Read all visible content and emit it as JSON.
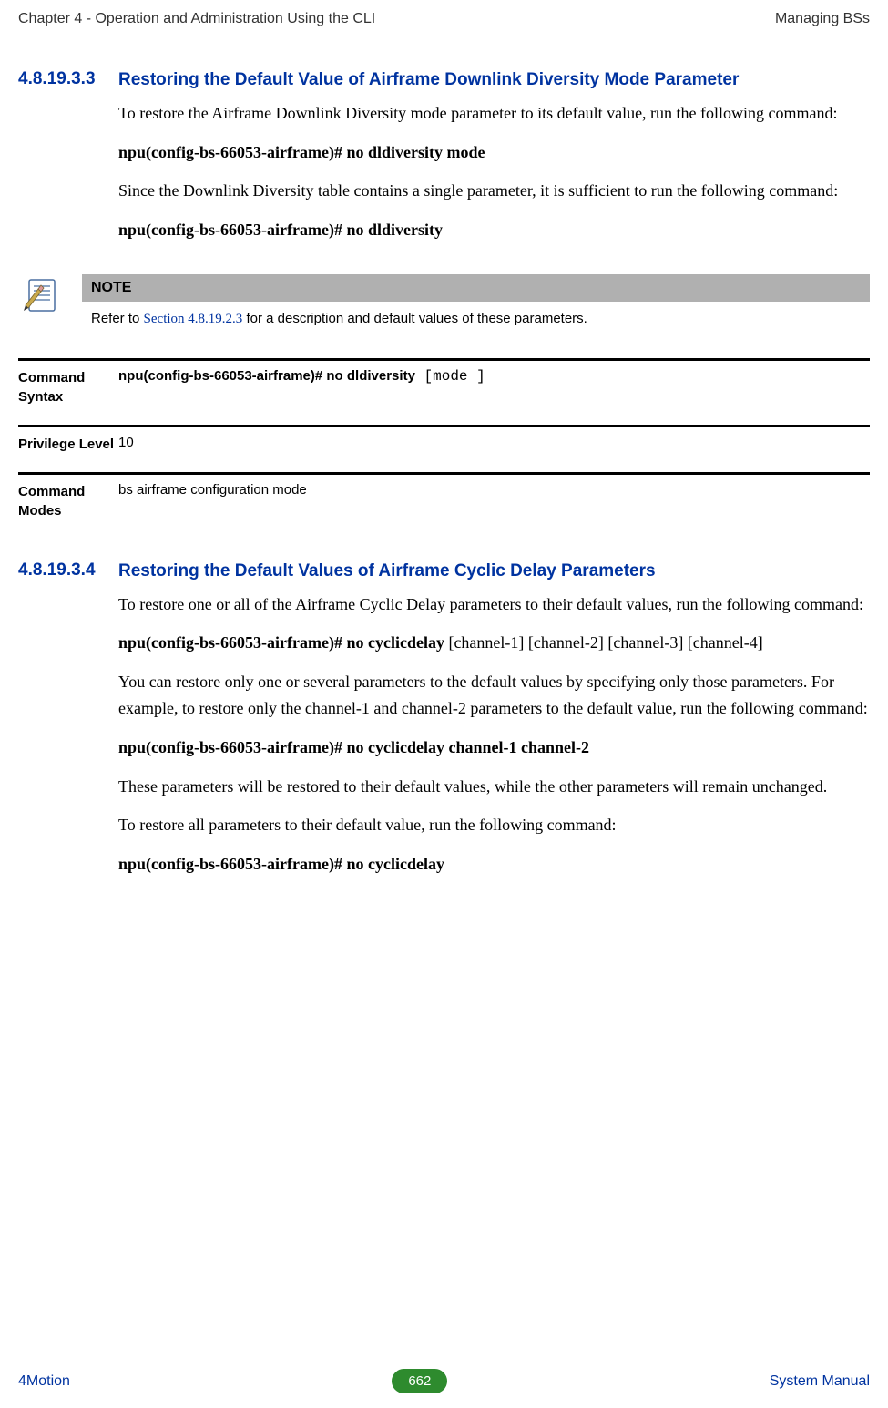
{
  "header": {
    "left": "Chapter 4 - Operation and Administration Using the CLI",
    "right": "Managing BSs"
  },
  "section1": {
    "num": "4.8.19.3.3",
    "title": "Restoring the Default Value of Airframe Downlink Diversity Mode Parameter",
    "para1": "To restore the Airframe Downlink Diversity mode parameter to its default value, run the following command:",
    "cmd1": "npu(config-bs-66053-airframe)# no dldiversity mode",
    "para2": "Since the Downlink Diversity table contains a single parameter, it is sufficient to run the following command:",
    "cmd2": "npu(config-bs-66053-airframe)# no dldiversity"
  },
  "note": {
    "header": "NOTE",
    "body_prefix": "Refer to ",
    "body_link": "Section 4.8.19.2.3",
    "body_suffix": " for a description and default values of these parameters."
  },
  "defs": [
    {
      "label": "Command Syntax",
      "value_bold": "npu(config-bs-66053-airframe)# no dldiversity",
      "value_mono": "  [mode ]"
    },
    {
      "label": "Privilege Level",
      "value": "10"
    },
    {
      "label": "Command Modes",
      "value": "bs airframe configuration mode"
    }
  ],
  "section2": {
    "num": "4.8.19.3.4",
    "title": "Restoring the Default Values of Airframe Cyclic Delay Parameters",
    "para1": "To restore one or all of the Airframe Cyclic Delay parameters to their default values, run the following command:",
    "cmd1_bold": "npu(config-bs-66053-airframe)# no cyclicdelay",
    "cmd1_rest": " [channel-1] [channel-2] [channel-3] [channel-4]",
    "para2": "You can restore only one or several parameters to the default values by specifying only those parameters. For example, to restore only the channel-1 and channel-2 parameters to the default value, run the following command:",
    "cmd2": "npu(config-bs-66053-airframe)# no cyclicdelay channel-1 channel-2",
    "para3": "These parameters will be restored to their default values, while the other parameters will remain unchanged.",
    "para4": "To restore all parameters to their default value, run the following command:",
    "cmd3": "npu(config-bs-66053-airframe)# no cyclicdelay"
  },
  "footer": {
    "left": "4Motion",
    "page": "662",
    "right": "System Manual"
  }
}
